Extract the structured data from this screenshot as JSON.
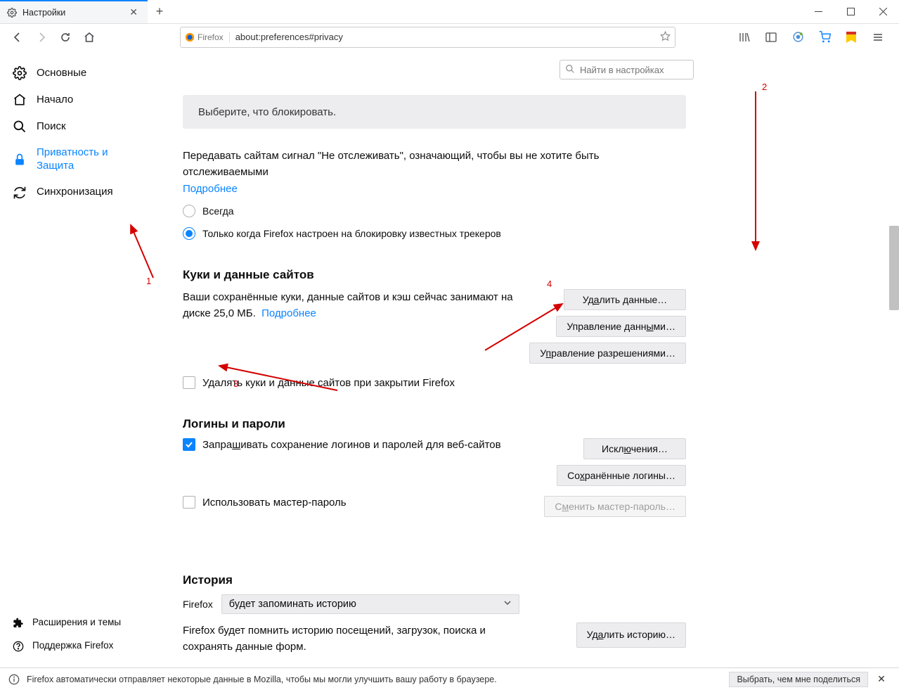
{
  "tab": {
    "title": "Настройки"
  },
  "urlbar": {
    "brand": "Firefox",
    "url": "about:preferences#privacy"
  },
  "search": {
    "placeholder": "Найти в настройках"
  },
  "sidebar": {
    "items": [
      {
        "label": "Основные"
      },
      {
        "label": "Начало"
      },
      {
        "label": "Поиск"
      },
      {
        "label": "Приватность и Защита"
      },
      {
        "label": "Синхронизация"
      }
    ],
    "bottom": [
      {
        "label": "Расширения и темы"
      },
      {
        "label": "Поддержка Firefox"
      }
    ]
  },
  "banner": "Выберите, что блокировать.",
  "dnt": {
    "text": "Передавать сайтам сигнал \"Не отслеживать\", означающий, чтобы вы не хотите быть отслеживаемыми",
    "more": "Подробнее",
    "opt_always": "Всегда",
    "opt_known": "Только когда Firefox настроен на блокировку известных трекеров"
  },
  "cookies": {
    "heading": "Куки и данные сайтов",
    "text1": "Ваши сохранённые куки, данные сайтов и кэш сейчас занимают на диске ",
    "size": "25,0 МБ.",
    "more": "Подробнее",
    "chk_delete": "Удалять куки и данные сайтов при закрытии Firefox",
    "btn_delete": "Удалить данные…",
    "btn_manage": "Управление данными…",
    "btn_permissions": "Управление разрешениями…"
  },
  "logins": {
    "heading": "Логины и пароли",
    "chk_ask": "Запрашивать сохранение логинов и паролей для веб-сайтов",
    "btn_exceptions": "Исключения…",
    "btn_saved": "Сохранённые логины…",
    "chk_master": "Использовать мастер-пароль",
    "btn_change": "Сменить мастер-пароль…"
  },
  "history": {
    "heading": "История",
    "label": "Firefox",
    "select": "будет запоминать историю",
    "text": "Firefox будет помнить историю посещений, загрузок, поиска и сохранять данные форм.",
    "btn_delete": "Удалить историю…"
  },
  "footer": {
    "text": "Firefox автоматически отправляет некоторые данные в Mozilla, чтобы мы могли улучшить вашу работу в браузере.",
    "share": "Выбрать, чем мне поделиться"
  },
  "annotations": {
    "a1": "1",
    "a2": "2",
    "a3": "3",
    "a4": "4"
  }
}
